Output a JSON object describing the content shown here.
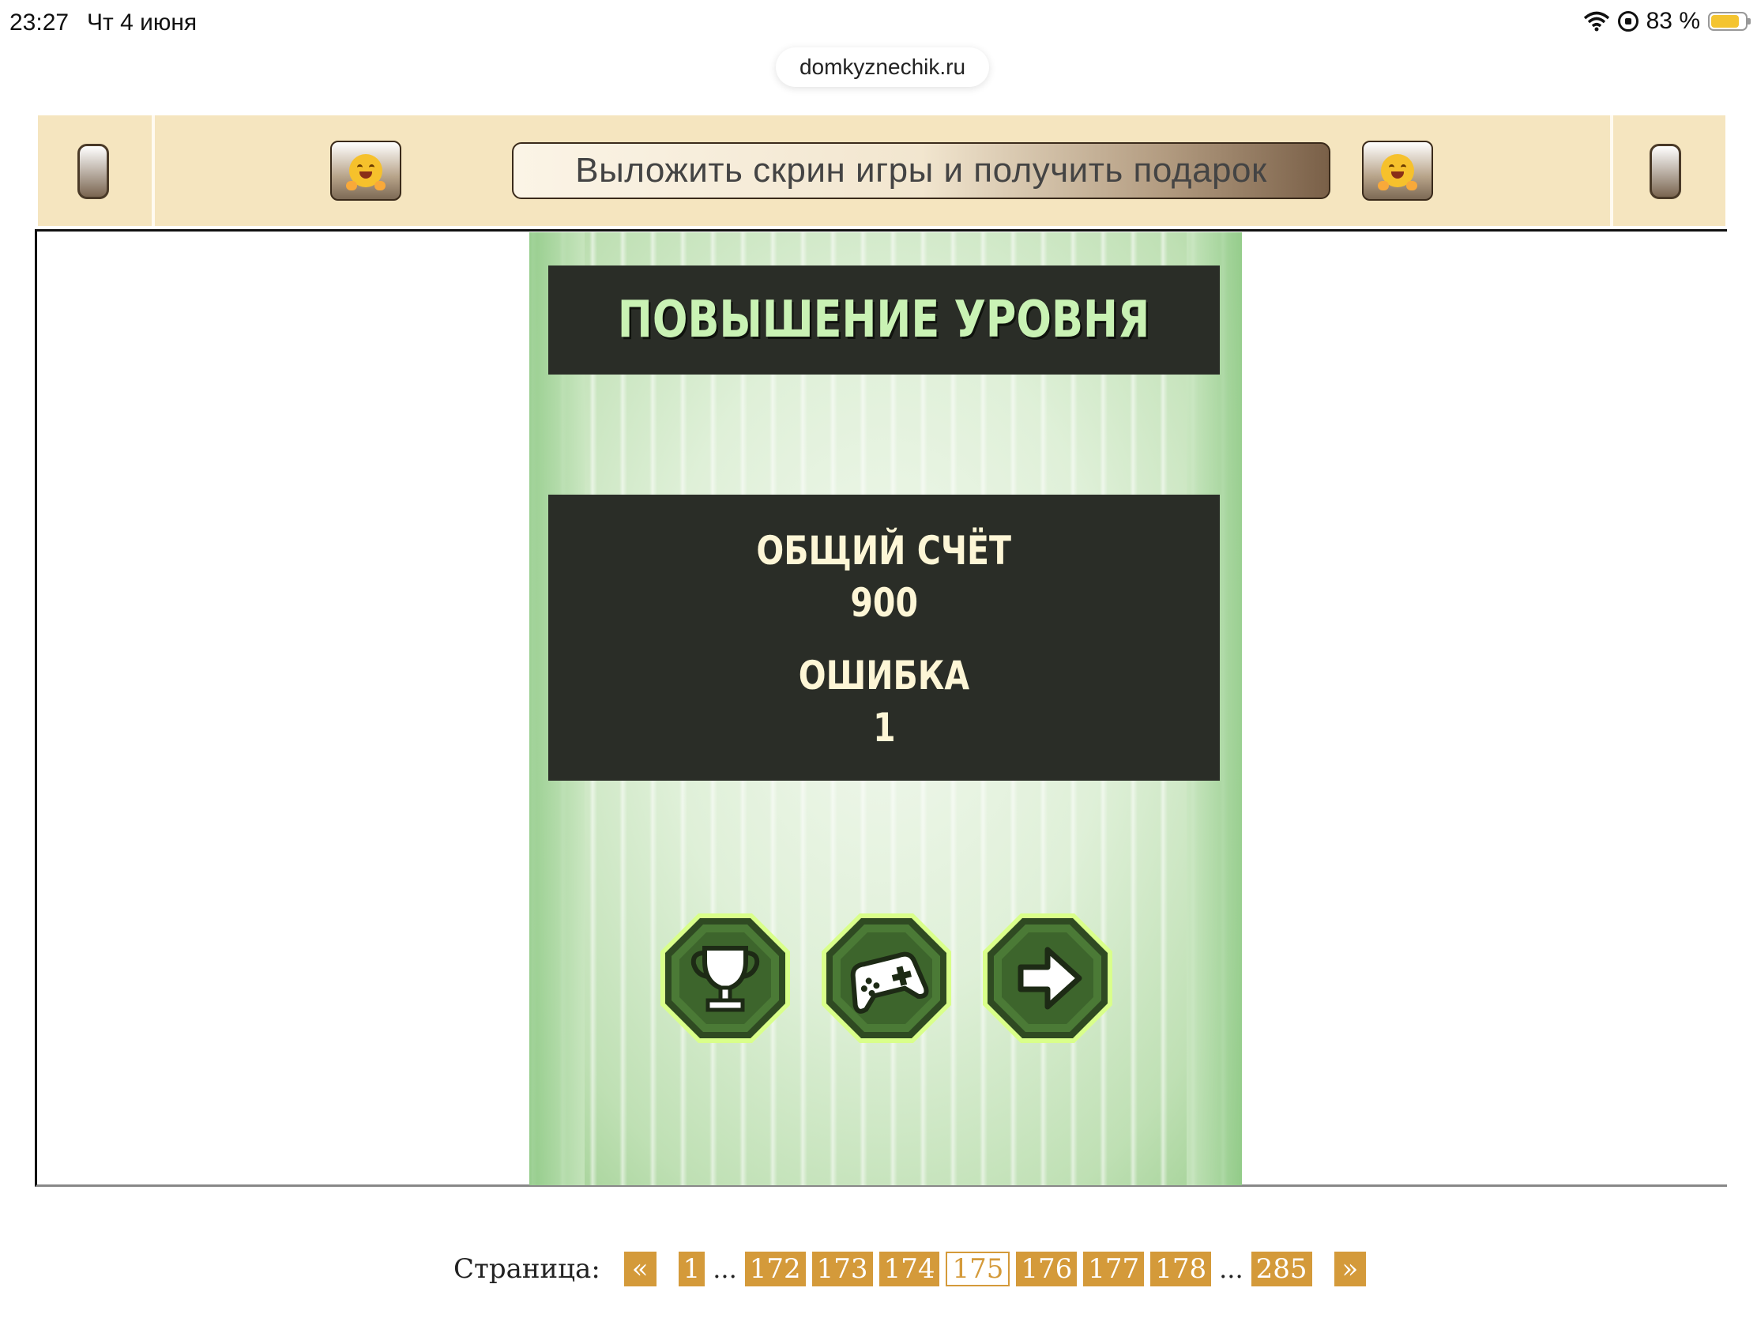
{
  "status_bar": {
    "time": "23:27",
    "date": "Чт 4 июня",
    "battery": "83 %",
    "battery_level": 0.83
  },
  "browser": {
    "url": "domkyznechik.ru"
  },
  "banner": {
    "button_label": "Выложить скрин игры и получить подарок",
    "emoji_left": "hugging-face-icon",
    "emoji_right": "hugging-face-icon"
  },
  "game": {
    "title": "ПОВЫШЕНИЕ УРОВНЯ",
    "score_label": "ОБЩИЙ СЧЁТ",
    "score_value": "900",
    "errors_label": "ОШИБКА",
    "errors_value": "1",
    "buttons": [
      "trophy-icon",
      "gamepad-icon",
      "arrow-right-icon"
    ]
  },
  "pagination": {
    "label": "Страница:",
    "prev": "«",
    "next": "»",
    "first": "1",
    "pages": [
      "172",
      "173",
      "174",
      "175",
      "176",
      "177",
      "178"
    ],
    "current": "175",
    "last": "285",
    "ellipsis": "..."
  },
  "colors": {
    "banner_bg": "#f5e5bf",
    "pager_accent": "#d49a3a",
    "game_title": "#c9f2b4",
    "game_panel": "#2a2d27"
  }
}
